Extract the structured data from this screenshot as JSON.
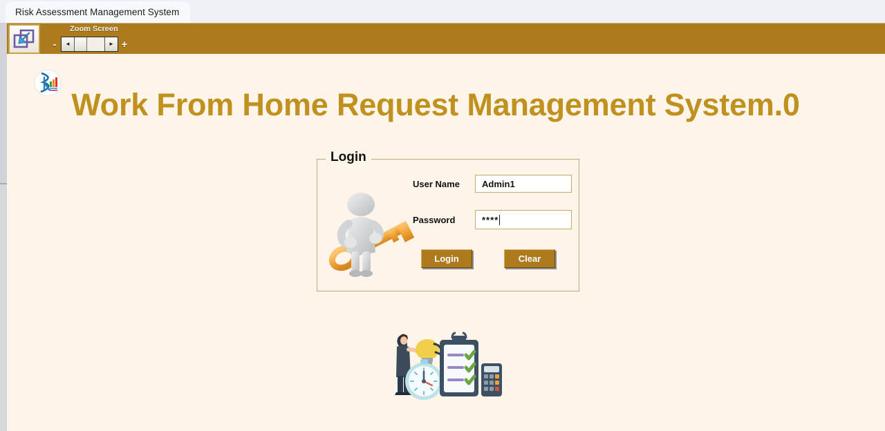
{
  "window": {
    "tab_title": "Risk Assessment Management System"
  },
  "toolbar": {
    "restore_icon": "restore-down-arrow-icon",
    "zoom_label": "Zoom Screen",
    "decrease_label": "-",
    "increase_label": "+",
    "left_arrow": "◄",
    "right_arrow": "►",
    "background_color": "#ad7a1d"
  },
  "app": {
    "logo_icon": "company-logo-icon",
    "title": "Work From Home Request Management System.0",
    "title_color": "#c0911f",
    "background_color": "#fdf5ea"
  },
  "login": {
    "legend": "Login",
    "illustration_icon": "person-holding-key-icon",
    "fields": [
      {
        "label": "User Name",
        "value": "Admin1",
        "placeholder": "",
        "masked": false,
        "focused": false
      },
      {
        "label": "Password",
        "value": "****",
        "placeholder": "",
        "masked": true,
        "focused": true
      }
    ],
    "buttons": [
      {
        "label": "Login"
      },
      {
        "label": "Clear"
      }
    ],
    "button_color": "#ad7a1d",
    "border_color": "#c7a96a"
  },
  "footer": {
    "illustration_icon": "business-productivity-checklist-icon"
  }
}
